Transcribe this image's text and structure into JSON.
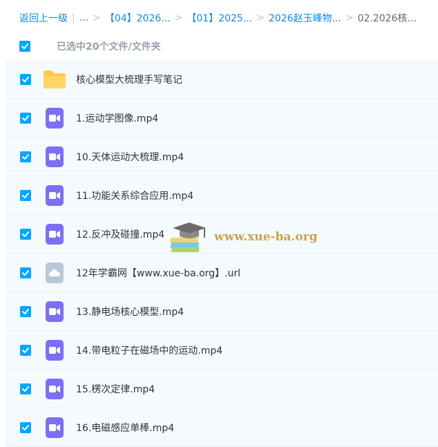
{
  "breadcrumb": {
    "back": "返回上一级",
    "divider": "|",
    "ellipsis": "...",
    "items": [
      "【04】2026...",
      "【01】2025...",
      "2026赵玉峰物...",
      "02.2026核..."
    ]
  },
  "selection": {
    "text": "已选中20个文件/文件夹"
  },
  "files": [
    {
      "name": "核心模型大梳理手写笔记",
      "type": "folder-icon"
    },
    {
      "name": "1.运动学图像.mp4",
      "type": "video-icon"
    },
    {
      "name": "10.天体运动大梳理.mp4",
      "type": "video-icon"
    },
    {
      "name": "11.功能关系综合应用.mp4",
      "type": "video-icon"
    },
    {
      "name": "12.反冲及碰撞.mp4",
      "type": "video-icon"
    },
    {
      "name": "12年学霸网【www.xue-ba.org】.url",
      "type": "url-icon"
    },
    {
      "name": "13.静电场核心模型.mp4",
      "type": "video-icon"
    },
    {
      "name": "14.带电粒子在磁场中的运动.mp4",
      "type": "video-icon"
    },
    {
      "name": "15.楞次定律.mp4",
      "type": "video-icon"
    },
    {
      "name": "16.电磁感应单棒.mp4",
      "type": "video-icon"
    }
  ],
  "watermark": {
    "text": "www.xue-ba.org"
  },
  "colors": {
    "link": "#0a8ad8",
    "checkbox": "#06a7ff",
    "video": "#7c6ef5",
    "folder": "#ffc94a",
    "row_bg": "#f5fafe"
  }
}
